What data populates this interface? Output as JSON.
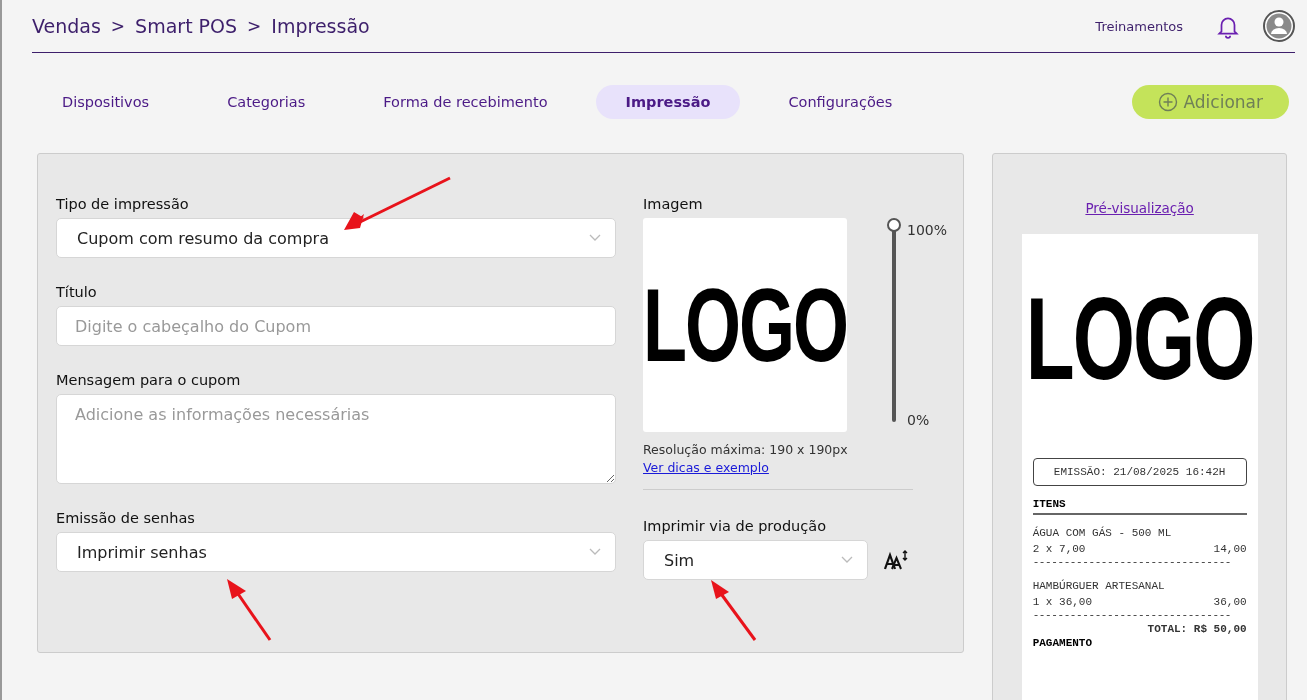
{
  "breadcrumb": [
    "Vendas",
    "Smart POS",
    "Impressão"
  ],
  "breadcrumb_separator": ">",
  "header": {
    "link": "Treinamentos"
  },
  "tabs": [
    {
      "label": "Dispositivos",
      "selected": false
    },
    {
      "label": "Categorias",
      "selected": false
    },
    {
      "label": "Forma de recebimento",
      "selected": false
    },
    {
      "label": "Impressão",
      "selected": true
    },
    {
      "label": "Configurações",
      "selected": false
    }
  ],
  "add_button": {
    "label": "Adicionar",
    "disabled": true
  },
  "form": {
    "print_type": {
      "label": "Tipo de impressão",
      "value": "Cupom com resumo da compra"
    },
    "title": {
      "label": "Título",
      "placeholder": "Digite o cabeçalho do Cupom"
    },
    "message": {
      "label": "Mensagem para o cupom",
      "placeholder": "Adicione as informações necessárias"
    },
    "passwords": {
      "label": "Emissão de senhas",
      "value": "Imprimir senhas"
    },
    "image": {
      "label": "Imagem",
      "logo_text": "LOGO",
      "size": {
        "level": 1,
        "max_label": "100%",
        "min_label": "0%"
      },
      "hint": "Resolução máxima: 190 x 190px",
      "link": "Ver dicas e exemplo"
    },
    "production": {
      "label": "Imprimir via de produção",
      "value": "Sim"
    }
  },
  "preview": {
    "link": "Pré-visualização",
    "logo_text": "LOGO",
    "emission": "EMISSÃO: 21/08/2025 16:42H",
    "items_title": "ITENS",
    "items": [
      {
        "name": "ÁGUA COM GÁS - 500 ML",
        "qty": "2 x 7,00",
        "amount": "14,00"
      },
      {
        "name": "HAMBÚRGUER ARTESANAL",
        "qty": "1 x 36,00",
        "amount": "36,00"
      }
    ],
    "divider": "--------------------------------",
    "total": "TOTAL: R$ 50,00",
    "payment_title": "PAGAMENTO"
  }
}
